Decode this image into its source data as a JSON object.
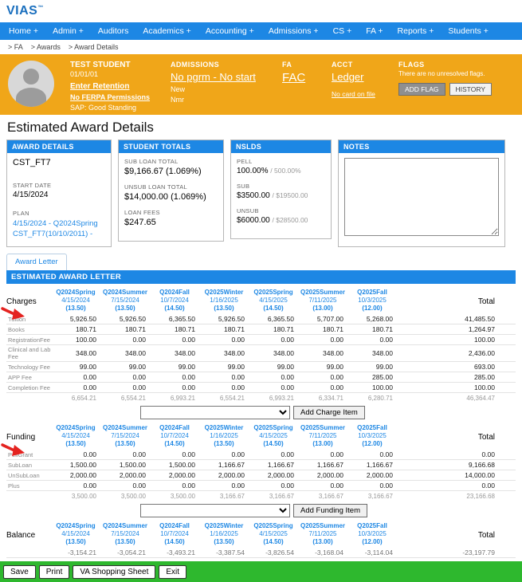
{
  "colors": {
    "blue": "#1d87e4",
    "logo_blue": "#1a6fbe",
    "gold": "#f0a619",
    "green": "#2eb82e",
    "red": "#e42320"
  },
  "brand": {
    "logo": "VIAS",
    "trademark": "™"
  },
  "nav": {
    "items": [
      "Home +",
      "Admin +",
      "Auditors",
      "Academics +",
      "Accounting +",
      "Admissions +",
      "CS +",
      "FA +",
      "Reports +",
      "Students +"
    ]
  },
  "breadcrumb": {
    "items": [
      "> FA",
      "> Awards",
      "> Award Details"
    ]
  },
  "banner": {
    "student": {
      "name": "TEST STUDENT",
      "dob": "01/01/01",
      "retention_link": "Enter Retention",
      "ferpa_link": "No FERPA Permissions",
      "sap": "SAP: Good Standing"
    },
    "admissions": {
      "title": "ADMISSIONS",
      "program_link": "No pgrm - No start",
      "line1": "New",
      "line2": "Nmr"
    },
    "fa": {
      "title": "FA",
      "link": "FAC"
    },
    "acct": {
      "title": "ACCT",
      "link": "Ledger",
      "card_link": "No card on file"
    },
    "flags": {
      "title": "FLAGS",
      "message": "There are no unresolved flags.",
      "add_button": "ADD FLAG",
      "history_button": "HISTORY"
    }
  },
  "page_title": "Estimated Award Details",
  "panels": {
    "award_details": {
      "title": "AWARD DETAILS",
      "code": "CST_FT7",
      "start_date_label": "START DATE",
      "start_date": "4/15/2024",
      "plan_label": "PLAN",
      "plan_link": "4/15/2024 - Q2024Spring CST_FT7(10/10/2011) -"
    },
    "student_totals": {
      "title": "STUDENT TOTALS",
      "rows": [
        {
          "label": "SUB LOAN TOTAL",
          "value": "$9,166.67 (1.069%)"
        },
        {
          "label": "UNSUB LOAN TOTAL",
          "value": "$14,000.00 (1.069%)"
        },
        {
          "label": "LOAN FEES",
          "value": "$247.65"
        }
      ]
    },
    "nslds": {
      "title": "NSLDS",
      "rows": [
        {
          "label": "PELL",
          "value": "100.00%",
          "limit": "/ 500.00%"
        },
        {
          "label": "SUB",
          "value": "$3500.00",
          "limit": "/ $19500.00"
        },
        {
          "label": "UNSUB",
          "value": "$6000.00",
          "limit": "/ $28500.00"
        }
      ]
    },
    "notes": {
      "title": "NOTES"
    }
  },
  "tabs": {
    "award_letter": "Award Letter"
  },
  "award_letter": {
    "header": "ESTIMATED AWARD LETTER",
    "total_label": "Total",
    "columns": [
      {
        "term": "Q2024Spring",
        "date": "4/15/2024",
        "credits": "(13.50)"
      },
      {
        "term": "Q2024Summer",
        "date": "7/15/2024",
        "credits": "(13.50)"
      },
      {
        "term": "Q2024Fall",
        "date": "10/7/2024",
        "credits": "(14.50)"
      },
      {
        "term": "Q2025Winter",
        "date": "1/16/2025",
        "credits": "(13.50)"
      },
      {
        "term": "Q2025Spring",
        "date": "4/15/2025",
        "credits": "(14.50)"
      },
      {
        "term": "Q2025Summer",
        "date": "7/11/2025",
        "credits": "(13.00)"
      },
      {
        "term": "Q2025Fall",
        "date": "10/3/2025",
        "credits": "(12.00)"
      }
    ],
    "charges": {
      "section_label": "Charges",
      "rows": [
        {
          "label": "Tuition",
          "values": [
            "5,926.50",
            "5,926.50",
            "6,365.50",
            "5,926.50",
            "6,365.50",
            "5,707.00",
            "5,268.00"
          ],
          "total": "41,485.50"
        },
        {
          "label": "Books",
          "values": [
            "180.71",
            "180.71",
            "180.71",
            "180.71",
            "180.71",
            "180.71",
            "180.71"
          ],
          "total": "1,264.97"
        },
        {
          "label": "RegistrationFee",
          "values": [
            "100.00",
            "0.00",
            "0.00",
            "0.00",
            "0.00",
            "0.00",
            "0.00"
          ],
          "total": "100.00"
        },
        {
          "label": "Clinical and Lab Fee",
          "values": [
            "348.00",
            "348.00",
            "348.00",
            "348.00",
            "348.00",
            "348.00",
            "348.00"
          ],
          "total": "2,436.00"
        },
        {
          "label": "Technology Fee",
          "values": [
            "99.00",
            "99.00",
            "99.00",
            "99.00",
            "99.00",
            "99.00",
            "99.00"
          ],
          "total": "693.00"
        },
        {
          "label": "APP Fee",
          "values": [
            "0.00",
            "0.00",
            "0.00",
            "0.00",
            "0.00",
            "0.00",
            "285.00"
          ],
          "total": "285.00"
        },
        {
          "label": "Completion Fee",
          "values": [
            "0.00",
            "0.00",
            "0.00",
            "0.00",
            "0.00",
            "0.00",
            "100.00"
          ],
          "total": "100.00"
        }
      ],
      "totals": [
        "6,654.21",
        "6,554.21",
        "6,993.21",
        "6,554.21",
        "6,993.21",
        "6,334.71",
        "6,280.71"
      ],
      "grand_total": "46,364.47",
      "add_button": "Add Charge Item"
    },
    "funding": {
      "section_label": "Funding",
      "rows": [
        {
          "label": "PellGrant",
          "values": [
            "0.00",
            "0.00",
            "0.00",
            "0.00",
            "0.00",
            "0.00",
            "0.00"
          ],
          "total": "0.00"
        },
        {
          "label": "SubLoan",
          "values": [
            "1,500.00",
            "1,500.00",
            "1,500.00",
            "1,166.67",
            "1,166.67",
            "1,166.67",
            "1,166.67"
          ],
          "total": "9,166.68"
        },
        {
          "label": "UnSubLoan",
          "values": [
            "2,000.00",
            "2,000.00",
            "2,000.00",
            "2,000.00",
            "2,000.00",
            "2,000.00",
            "2,000.00"
          ],
          "total": "14,000.00"
        },
        {
          "label": "Plus",
          "values": [
            "0.00",
            "0.00",
            "0.00",
            "0.00",
            "0.00",
            "0.00",
            "0.00"
          ],
          "total": "0.00"
        }
      ],
      "totals": [
        "3,500.00",
        "3,500.00",
        "3,500.00",
        "3,166.67",
        "3,166.67",
        "3,166.67",
        "3,166.67"
      ],
      "grand_total": "23,166.68",
      "add_button": "Add Funding Item"
    },
    "balance": {
      "section_label": "Balance",
      "rows": [
        {
          "label": "",
          "values": [
            "-3,154.21",
            "-3,054.21",
            "-3,493.21",
            "-3,387.54",
            "-3,826.54",
            "-3,168.04",
            "-3,114.04"
          ],
          "total": "-23,197.79"
        }
      ]
    }
  },
  "footer": {
    "buttons": [
      "Save",
      "Print",
      "VA Shopping Sheet",
      "Exit"
    ]
  }
}
